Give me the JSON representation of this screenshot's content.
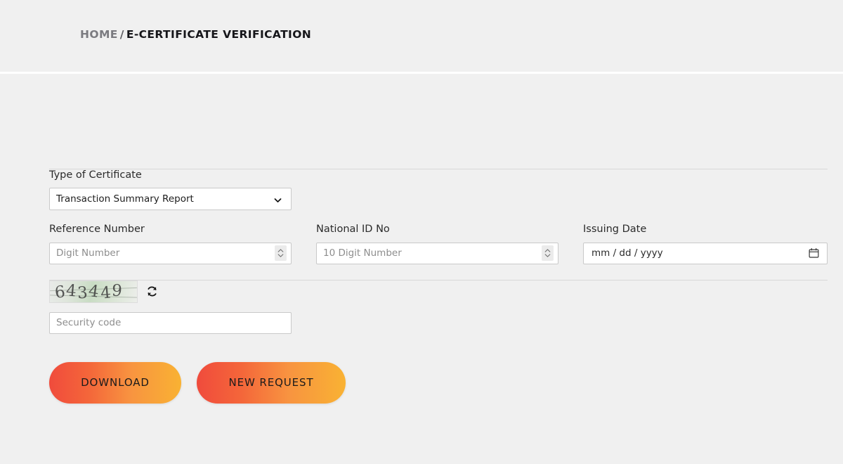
{
  "breadcrumb": {
    "home": "HOME",
    "separator": "/",
    "current": "E-CERTIFICATE VERIFICATION"
  },
  "form": {
    "certificate_type": {
      "label": "Type of Certificate",
      "value": "Transaction Summary Report",
      "icon": "chevron-down-icon"
    },
    "reference_number": {
      "label": "Reference Number",
      "placeholder": "Digit Number",
      "value": ""
    },
    "national_id": {
      "label": "National ID No",
      "placeholder": "10 Digit Number",
      "value": ""
    },
    "issuing_date": {
      "label": "Issuing Date",
      "value": "mm / dd / yyyy",
      "icon": "calendar-icon"
    },
    "captcha": {
      "code": "643449",
      "digits": [
        "6",
        "4",
        "3",
        "4",
        "4",
        "9"
      ],
      "refresh_icon": "refresh-icon"
    },
    "security_code": {
      "placeholder": "Security code",
      "value": ""
    }
  },
  "actions": {
    "download": "DOWNLOAD",
    "new_request": "NEW REQUEST"
  },
  "colors": {
    "page_background": "#f0f0f0",
    "button_gradient_start": "#f04b3c",
    "button_gradient_end": "#f9b233",
    "divider": "#d8d8d8",
    "input_border": "#c9c9c9",
    "placeholder_text": "#8d8d8d"
  }
}
